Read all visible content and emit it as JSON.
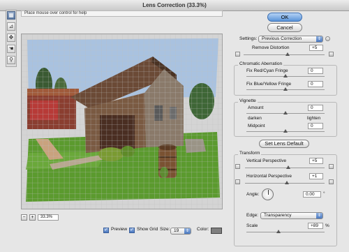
{
  "window": {
    "title": "Lens Correction (33.3%)"
  },
  "help_text": "Place mouse over control for help",
  "tools": [
    {
      "icon": "remove-distortion-tool-icon",
      "glyph": "▦"
    },
    {
      "icon": "straighten-tool-icon",
      "glyph": "⊿"
    },
    {
      "icon": "move-grid-tool-icon",
      "glyph": "✥"
    },
    {
      "icon": "hand-tool-icon",
      "glyph": "☚"
    },
    {
      "icon": "zoom-tool-icon",
      "glyph": "⚲"
    }
  ],
  "zoom": {
    "minus": "−",
    "plus": "+",
    "value": "33.3%"
  },
  "options": {
    "preview_label": "Preview",
    "show_grid_label": "Show Grid",
    "size_label": "Size:",
    "size_value": "19",
    "color_label": "Color:",
    "grid_color": "#7f7f7f"
  },
  "buttons": {
    "ok": "OK",
    "cancel": "Cancel",
    "set_lens_default": "Set Lens Default"
  },
  "settings": {
    "label": "Settings:",
    "value": "Previous Correction"
  },
  "remove_distortion": {
    "label": "Remove Distortion",
    "value": "+5"
  },
  "chromatic": {
    "title": "Chromatic Aberration",
    "red_cyan_label": "Fix Red/Cyan Fringe",
    "red_cyan_value": "0",
    "blue_yellow_label": "Fix Blue/Yellow Fringe",
    "blue_yellow_value": "0"
  },
  "vignette": {
    "title": "Vignette",
    "amount_label": "Amount",
    "amount_value": "0",
    "darken_label": "darken",
    "lighten_label": "lighten",
    "midpoint_label": "Midpoint",
    "midpoint_value": "0"
  },
  "transform": {
    "title": "Transform",
    "vertical_label": "Vertical Perspective",
    "vertical_value": "+5",
    "horizontal_label": "Horizontal Perspective",
    "horizontal_value": "+1",
    "angle_label": "Angle:",
    "angle_value": "0.00",
    "angle_unit": "°",
    "edge_label": "Edge:",
    "edge_value": "Transparency",
    "scale_label": "Scale",
    "scale_value": "+89",
    "scale_unit": "%"
  },
  "colors": {
    "accent": "#4a78c0",
    "sky": "#a9c2e0",
    "grass": "#5b9a2e",
    "barn": "#6b4a36"
  }
}
